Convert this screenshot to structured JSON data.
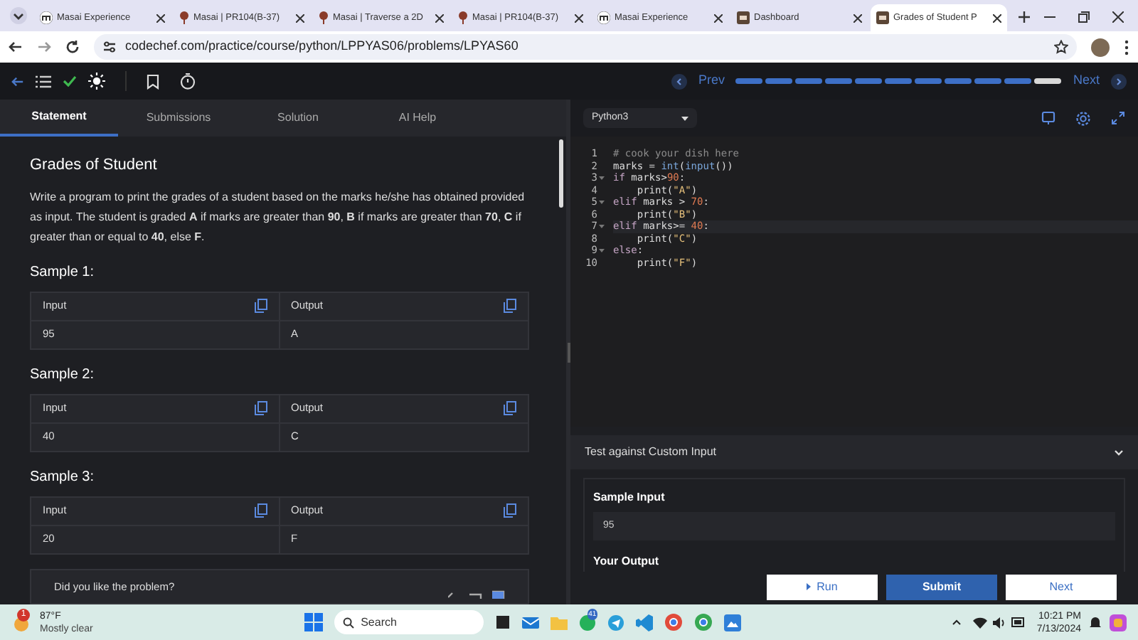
{
  "browser": {
    "tabs": [
      {
        "title": "Masai Experience",
        "kind": "letter",
        "selected": false
      },
      {
        "title": "Masai | PR104(B-37)",
        "kind": "pin",
        "selected": false
      },
      {
        "title": "Masai | Traverse a 2D",
        "kind": "pin",
        "selected": false
      },
      {
        "title": "Masai | PR104(B-37)",
        "kind": "pin",
        "selected": false
      },
      {
        "title": "Masai Experience",
        "kind": "letter",
        "selected": false
      },
      {
        "title": "Dashboard",
        "kind": "square",
        "selected": false
      },
      {
        "title": "Grades of Student P",
        "kind": "square",
        "selected": true
      }
    ],
    "url": "codechef.com/practice/course/python/LPPYAS06/problems/LPYAS60"
  },
  "toolbar": {
    "prev": "Prev",
    "next": "Next",
    "progress": [
      {
        "current": false
      },
      {
        "current": false
      },
      {
        "current": false
      },
      {
        "current": false
      },
      {
        "current": false
      },
      {
        "current": false
      },
      {
        "current": false
      },
      {
        "current": false
      },
      {
        "current": false
      },
      {
        "current": false
      },
      {
        "current": true
      }
    ]
  },
  "left_tabs": [
    {
      "label": "Statement",
      "selected": true
    },
    {
      "label": "Submissions",
      "selected": false
    },
    {
      "label": "Solution",
      "selected": false
    },
    {
      "label": "AI Help",
      "selected": false
    }
  ],
  "problem": {
    "title": "Grades of Student",
    "statement": "Write a program to print the grades of a student based on the marks he/she has obtained provided as input. The student is graded **A** if marks are greater than **90**, **B** if marks are greater than **70**, **C** if greater than or equal to **40**, else **F**.",
    "samples": [
      {
        "title": "Sample 1:",
        "input_label": "Input",
        "output_label": "Output",
        "input": "95",
        "output": "A"
      },
      {
        "title": "Sample 2:",
        "input_label": "Input",
        "output_label": "Output",
        "input": "40",
        "output": "C"
      },
      {
        "title": "Sample 3:",
        "input_label": "Input",
        "output_label": "Output",
        "input": "20",
        "output": "F"
      }
    ],
    "feedback": "Did you like the problem?"
  },
  "editor": {
    "language": "Python3",
    "lines": [
      {
        "number": "1",
        "foldable": false,
        "tokens": [
          {
            "text": "# cook your dish here",
            "kind": "comment"
          }
        ]
      },
      {
        "number": "2",
        "foldable": false,
        "tokens": [
          {
            "text": "marks = ",
            "kind": "plain"
          },
          {
            "text": "int",
            "kind": "builtin"
          },
          {
            "text": "(",
            "kind": "plain"
          },
          {
            "text": "input",
            "kind": "builtin"
          },
          {
            "text": "())",
            "kind": "plain"
          }
        ]
      },
      {
        "number": "3",
        "foldable": true,
        "tokens": [
          {
            "text": "if",
            "kind": "keyword"
          },
          {
            "text": " marks>",
            "kind": "plain"
          },
          {
            "text": "90",
            "kind": "number"
          },
          {
            "text": ":",
            "kind": "plain"
          }
        ]
      },
      {
        "number": "4",
        "foldable": false,
        "tokens": [
          {
            "text": "    print(",
            "kind": "plain"
          },
          {
            "text": "\"A\"",
            "kind": "string"
          },
          {
            "text": ")",
            "kind": "plain"
          }
        ]
      },
      {
        "number": "5",
        "foldable": true,
        "tokens": [
          {
            "text": "elif",
            "kind": "keyword"
          },
          {
            "text": " marks > ",
            "kind": "plain"
          },
          {
            "text": "70",
            "kind": "number"
          },
          {
            "text": ":",
            "kind": "plain"
          }
        ]
      },
      {
        "number": "6",
        "foldable": false,
        "tokens": [
          {
            "text": "    print(",
            "kind": "plain"
          },
          {
            "text": "\"B\"",
            "kind": "string"
          },
          {
            "text": ")",
            "kind": "plain"
          }
        ]
      },
      {
        "number": "7",
        "foldable": true,
        "tokens": [
          {
            "text": "elif",
            "kind": "keyword"
          },
          {
            "text": " marks>= ",
            "kind": "plain"
          },
          {
            "text": "40",
            "kind": "number"
          },
          {
            "text": ":",
            "kind": "plain"
          }
        ]
      },
      {
        "number": "8",
        "foldable": false,
        "tokens": [
          {
            "text": "    print(",
            "kind": "plain"
          },
          {
            "text": "\"C\"",
            "kind": "string"
          },
          {
            "text": ")",
            "kind": "plain"
          }
        ]
      },
      {
        "number": "9",
        "foldable": true,
        "tokens": [
          {
            "text": "else",
            "kind": "keyword"
          },
          {
            "text": ":",
            "kind": "plain"
          }
        ]
      },
      {
        "number": "10",
        "foldable": false,
        "tokens": [
          {
            "text": "    print(",
            "kind": "plain"
          },
          {
            "text": "\"F\"",
            "kind": "string"
          },
          {
            "text": ")",
            "kind": "plain"
          }
        ]
      }
    ]
  },
  "custom_input": {
    "title": "Test against Custom Input",
    "sample_input_label": "Sample Input",
    "sample_input": "95",
    "output_label": "Your Output"
  },
  "actions": {
    "run": "Run",
    "submit": "Submit",
    "next": "Next"
  },
  "taskbar": {
    "temperature": "87°F",
    "weather": "Mostly clear",
    "weather_badge": "1",
    "search": "Search",
    "whatsapp_badge": "41",
    "time": "10:21 PM",
    "date": "7/13/2024"
  }
}
